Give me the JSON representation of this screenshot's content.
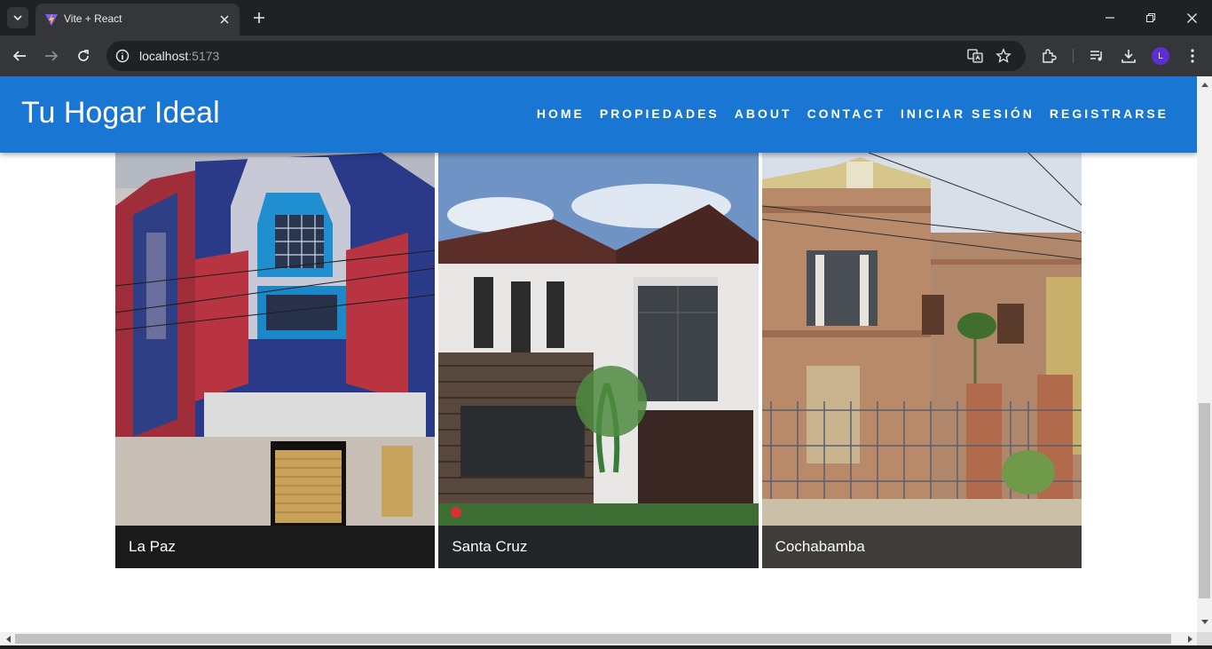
{
  "browser": {
    "tab_title": "Vite + React",
    "url_host": "localhost",
    "url_port": ":5173",
    "profile_initial": "L"
  },
  "site": {
    "logo": "Tu Hogar Ideal",
    "nav": [
      "HOME",
      "PROPIEDADES",
      "ABOUT",
      "CONTACT",
      "INICIAR SESIÓN",
      "REGISTRARSE"
    ],
    "brand_color": "#1976d2"
  },
  "cards": [
    {
      "city": "La Paz",
      "image": "colorful-cholet-building-photo"
    },
    {
      "city": "Santa Cruz",
      "image": "modern-white-house-photo"
    },
    {
      "city": "Cochabamba",
      "image": "historic-brick-house-photo"
    }
  ]
}
